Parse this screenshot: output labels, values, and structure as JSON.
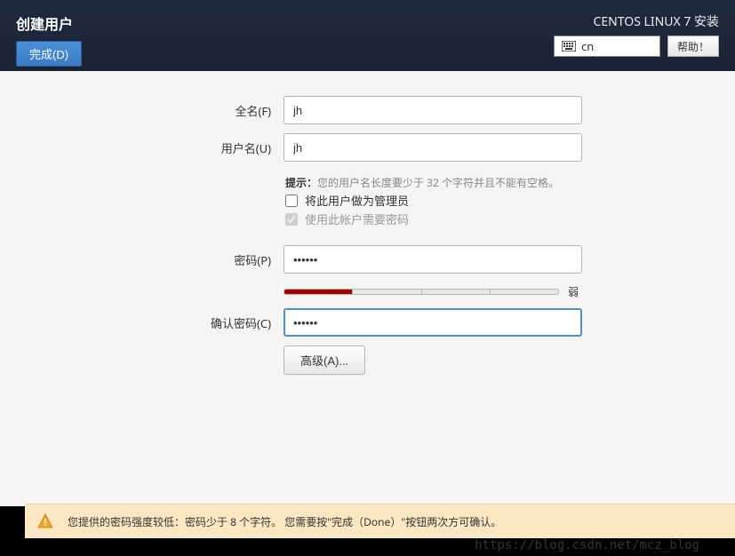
{
  "header": {
    "page_title": "创建用户",
    "done_button": "完成(D)",
    "installer_title": "CENTOS LINUX 7 安装",
    "lang_code": "cn",
    "help_button": "帮助！"
  },
  "form": {
    "fullname_label": "全名(F)",
    "fullname_value": "jh",
    "username_label": "用户名(U)",
    "username_value": "jh",
    "hint_prefix": "提示：",
    "hint_text": "您的用户名长度要少于 32 个字符并且不能有空格。",
    "admin_checkbox_label": "将此用户做为管理员",
    "admin_checked": false,
    "require_password_label": "使用此帐户需要密码",
    "require_password_checked": true,
    "password_label": "密码(P)",
    "password_value": "••••••",
    "strength_text": "弱",
    "confirm_label": "确认密码(C)",
    "confirm_value": "••••••",
    "advanced_button": "高级(A)..."
  },
  "warning": {
    "text": "您提供的密码强度较低：密码少于 8 个字符。 您需要按\"完成（Done）\"按钮两次方可确认。"
  },
  "watermark": "https://blog.csdn.net/mcz_blog"
}
